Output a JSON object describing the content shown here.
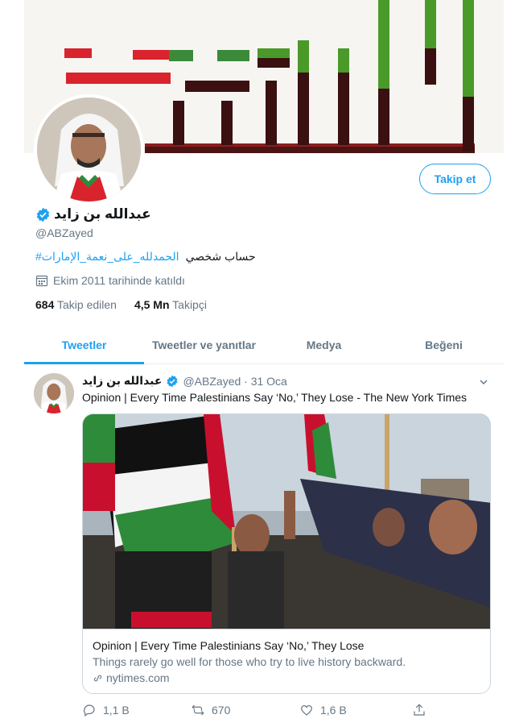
{
  "profile": {
    "name": "عبدالله بن زايد",
    "handle": "@ABZayed",
    "follow_label": "Takip et",
    "bio_text": "حساب شخصي",
    "bio_hashtag": "#الحمدلله_على_نعمة_الإمارات",
    "joined": "Ekim 2011 tarihinde katıldı",
    "following_count": "684",
    "following_label": "Takip edilen",
    "followers_count": "4,5 Mn",
    "followers_label": "Takipçi"
  },
  "tabs": [
    {
      "label": "Tweetler",
      "active": true
    },
    {
      "label": "Tweetler ve yanıtlar",
      "active": false
    },
    {
      "label": "Medya",
      "active": false
    },
    {
      "label": "Beğeni",
      "active": false
    }
  ],
  "tweet": {
    "name": "عبدالله بن زايد",
    "handle_date": "@ABZayed · 31 Oca",
    "text": "Opinion | Every Time Palestinians Say ‘No,’ They Lose - The New York Times",
    "card": {
      "title": "Opinion | Every Time Palestinians Say ‘No,’ They Lose",
      "description": "Things rarely go well for those who try to live history backward.",
      "domain": "nytimes.com"
    },
    "actions": {
      "replies": "1,1 B",
      "retweets": "670",
      "likes": "1,6 B"
    }
  },
  "colors": {
    "accent": "#1da1f2",
    "flag_red": "#c8102e",
    "flag_green": "#3a8a3a"
  }
}
